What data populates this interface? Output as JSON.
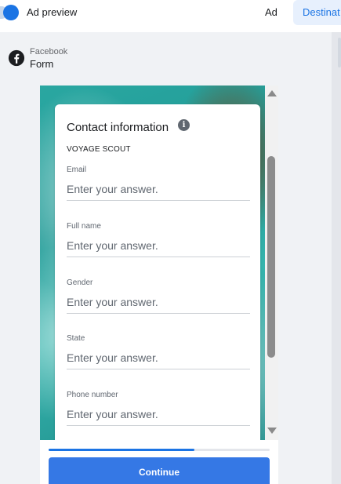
{
  "header": {
    "title": "Ad preview",
    "tabs": [
      {
        "label": "Ad",
        "active": false
      },
      {
        "label": "Destinat",
        "active": true
      }
    ]
  },
  "source": {
    "platform": "Facebook",
    "type": "Form"
  },
  "form": {
    "title": "Contact information",
    "brand": "VOYAGE SCOUT",
    "fields": [
      {
        "label": "Email",
        "placeholder": "Enter your answer."
      },
      {
        "label": "Full name",
        "placeholder": "Enter your answer."
      },
      {
        "label": "Gender",
        "placeholder": "Enter your answer."
      },
      {
        "label": "State",
        "placeholder": "Enter your answer."
      },
      {
        "label": "Phone number",
        "placeholder": "Enter your answer."
      }
    ]
  },
  "footer": {
    "progress": 0.66,
    "continue_label": "Continue"
  },
  "colors": {
    "accent": "#1b74e4",
    "button": "#3578e5"
  }
}
